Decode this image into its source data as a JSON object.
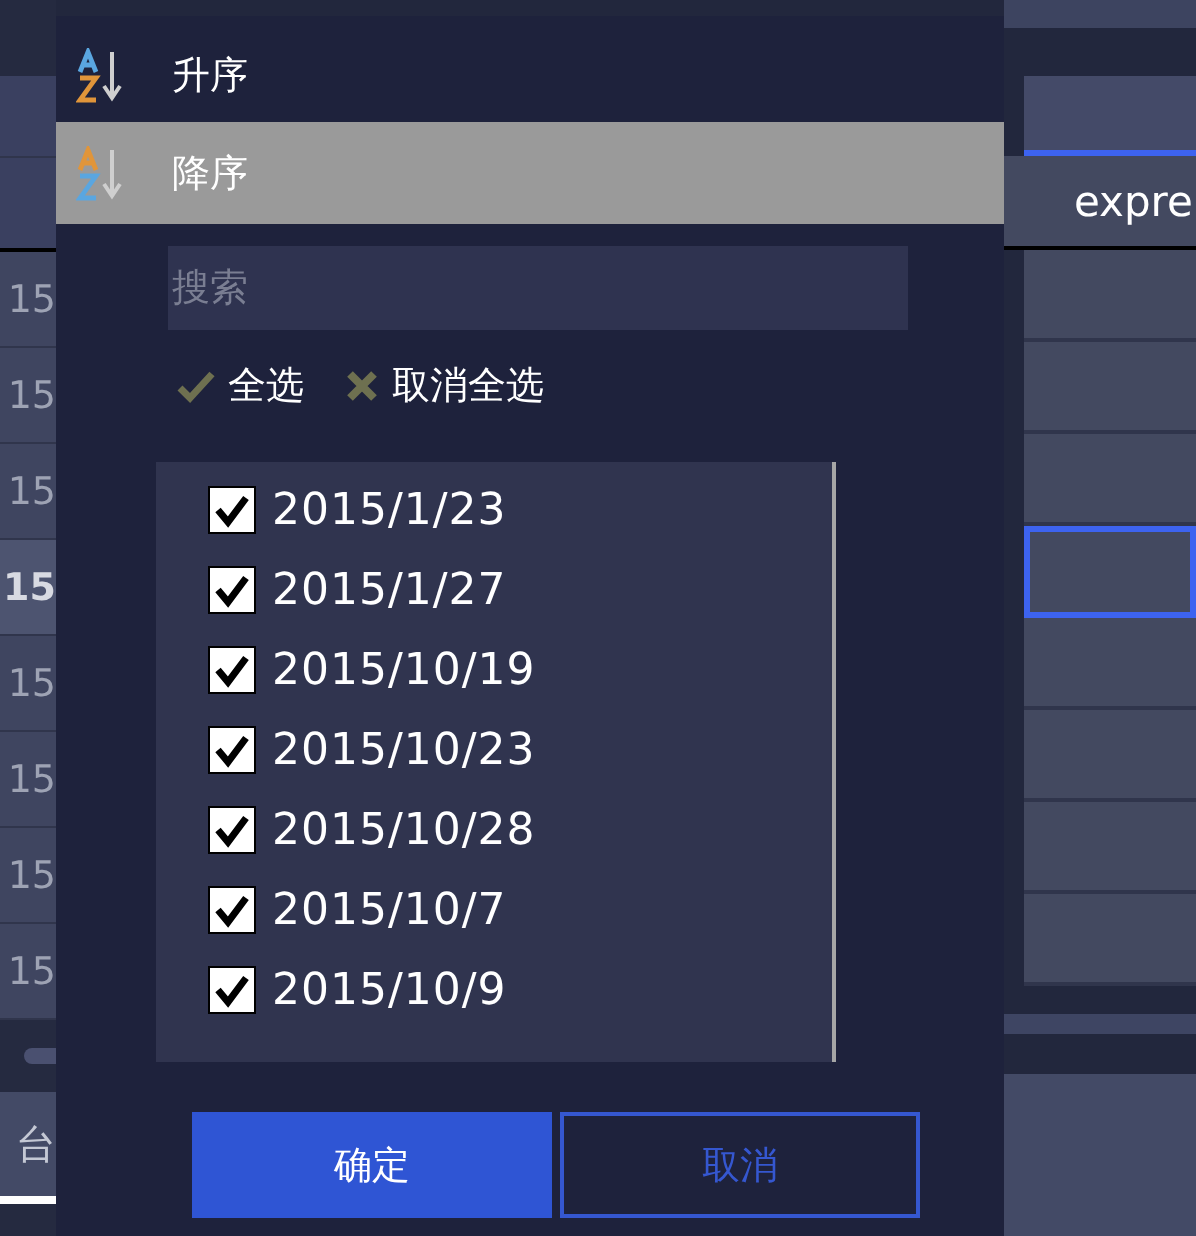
{
  "background": {
    "left_cells": [
      {
        "text": "15",
        "selected": false
      },
      {
        "text": "15",
        "selected": false
      },
      {
        "text": "15",
        "selected": false
      },
      {
        "text": "15",
        "selected": true
      },
      {
        "text": "15",
        "selected": false
      },
      {
        "text": "15",
        "selected": false
      },
      {
        "text": "15",
        "selected": false
      },
      {
        "text": "15",
        "selected": false
      }
    ],
    "left_tab": "台",
    "right_header": "expre",
    "right_cells": [
      {
        "selected": false
      },
      {
        "selected": false
      },
      {
        "selected": false
      },
      {
        "selected": true
      },
      {
        "selected": false
      },
      {
        "selected": false
      },
      {
        "selected": false
      },
      {
        "selected": false
      }
    ]
  },
  "sort_options": [
    {
      "label": "升序",
      "kind": "ascending",
      "selected": false
    },
    {
      "label": "降序",
      "kind": "descending",
      "selected": true
    }
  ],
  "search": {
    "placeholder": "搜索"
  },
  "select_all": "全选",
  "deselect_all": "取消全选",
  "values": [
    {
      "label": "2015/1/23",
      "checked": true
    },
    {
      "label": "2015/1/27",
      "checked": true
    },
    {
      "label": "2015/10/19",
      "checked": true
    },
    {
      "label": "2015/10/23",
      "checked": true
    },
    {
      "label": "2015/10/28",
      "checked": true
    },
    {
      "label": "2015/10/7",
      "checked": true
    },
    {
      "label": "2015/10/9",
      "checked": true
    }
  ],
  "buttons": [
    {
      "label": "确定",
      "kind": "primary"
    },
    {
      "label": "取消",
      "kind": "secondary"
    }
  ]
}
